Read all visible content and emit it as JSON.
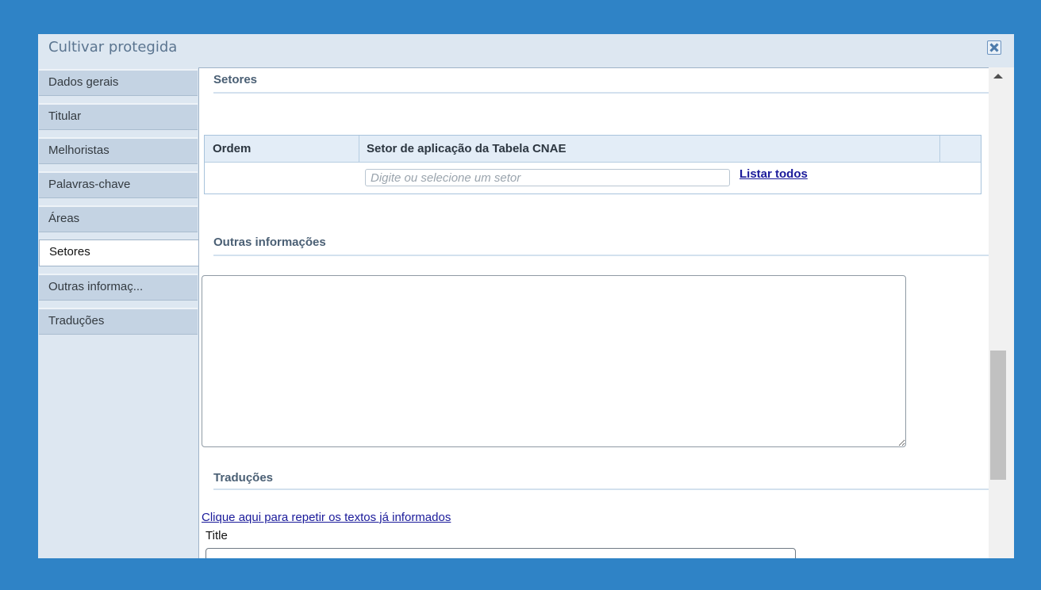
{
  "dialog": {
    "title": "Cultivar protegida",
    "close_icon": "close-icon"
  },
  "sidebar": {
    "items": [
      {
        "label": "Dados gerais"
      },
      {
        "label": "Titular"
      },
      {
        "label": "Melhoristas"
      },
      {
        "label": "Palavras-chave"
      },
      {
        "label": "Áreas"
      },
      {
        "label": "Setores",
        "active": true
      },
      {
        "label": "Outras informaç..."
      },
      {
        "label": "Traduções"
      }
    ]
  },
  "sections": {
    "setores": {
      "heading": "Setores",
      "table": {
        "headers": [
          "Ordem",
          "Setor de aplicação da Tabela CNAE",
          ""
        ],
        "input_placeholder": "Digite ou selecione um setor",
        "list_all_link": "Listar todos"
      }
    },
    "outras": {
      "heading": "Outras informações",
      "textarea_value": ""
    },
    "traducoes": {
      "heading": "Traduções",
      "repeat_link": "Clique aqui para repetir os textos já informados",
      "title_label": "Title",
      "title_value": ""
    }
  },
  "colors": {
    "background": "#2f83c6",
    "panel": "#dde7f1",
    "tab": "#c4d3e3",
    "link": "#1a1a9a"
  }
}
